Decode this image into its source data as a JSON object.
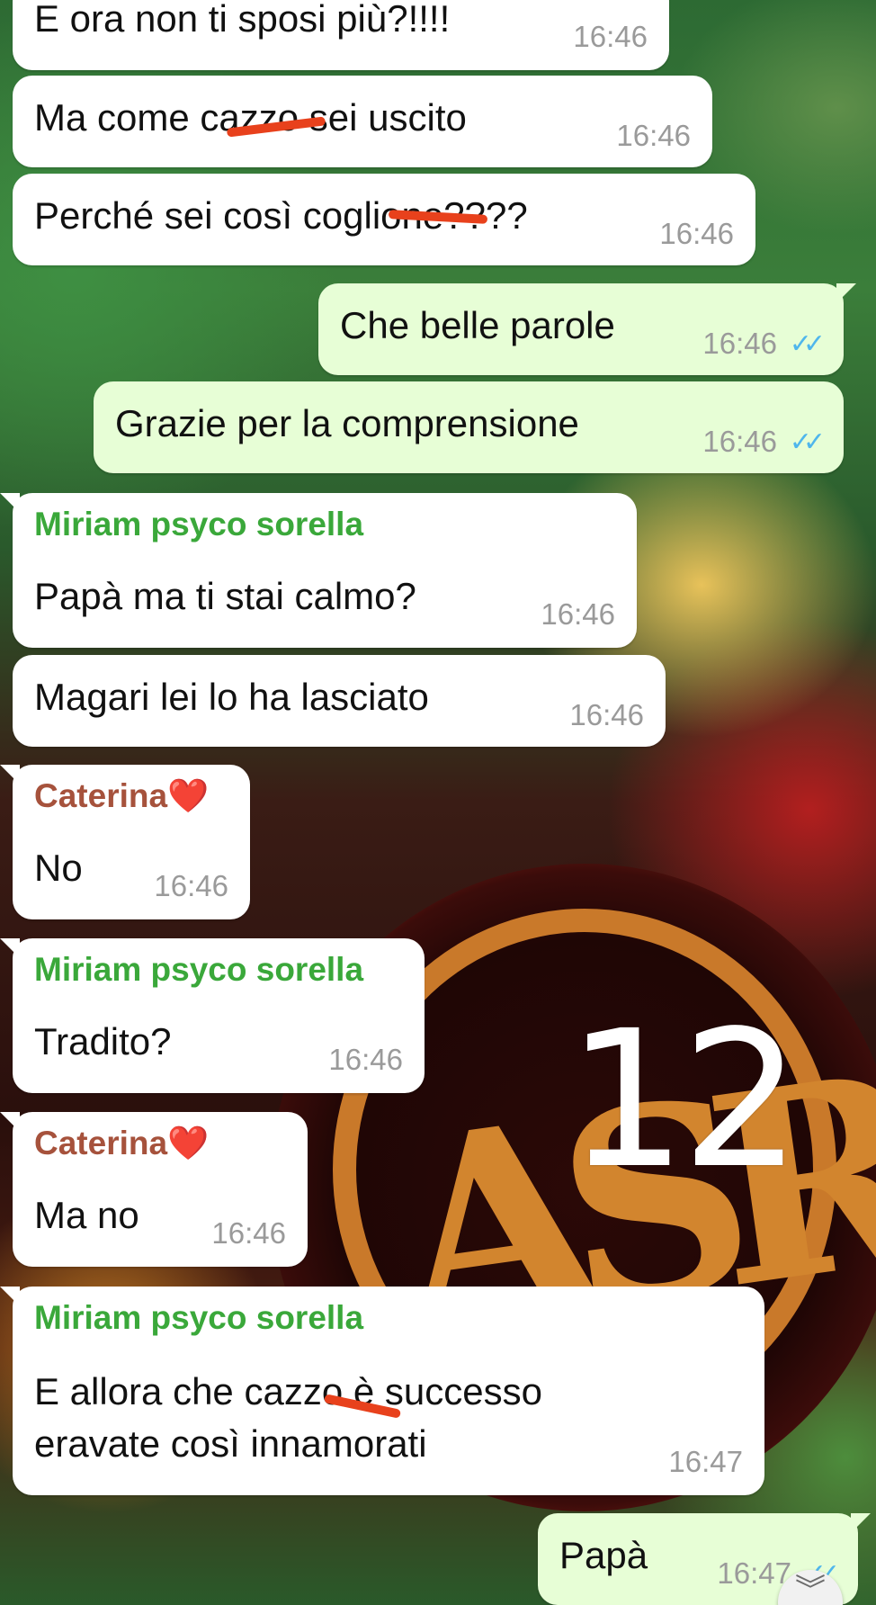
{
  "colors": {
    "incoming_bubble": "#ffffff",
    "outgoing_bubble": "#e7fed6",
    "sender_miriam": "#3aa83a",
    "sender_caterina": "#a6523c",
    "read_ticks": "#4fb6ec",
    "redaction": "#e8411c"
  },
  "messages": [
    {
      "text": "E ora non ti sposi più?!!!!",
      "time": "16:46"
    },
    {
      "text": "Ma come cazzo sei uscito",
      "time": "16:46"
    },
    {
      "text": "Perché sei così coglione????",
      "time": "16:46"
    },
    {
      "text": "Che belle parole",
      "time": "16:46",
      "ticks": "✓✓"
    },
    {
      "text": "Grazie per la comprensione",
      "time": "16:46",
      "ticks": "✓✓"
    },
    {
      "sender": "Miriam psyco sorella",
      "text": "Papà ma ti stai calmo?",
      "time": "16:46"
    },
    {
      "text": "Magari lei lo ha lasciato",
      "time": "16:46"
    },
    {
      "sender": "Caterina❤️",
      "text": "No",
      "time": "16:46"
    },
    {
      "sender": "Miriam psyco sorella",
      "text": "Tradito?",
      "time": "16:46"
    },
    {
      "sender": "Caterina❤️",
      "text": "Ma no",
      "time": "16:46"
    },
    {
      "sender": "Miriam psyco sorella",
      "line1": "E allora che cazzo è successo",
      "line2": "eravate così innamorati",
      "time": "16:47"
    },
    {
      "text": "Papà",
      "time": "16:47",
      "ticks": "✓✓"
    }
  ],
  "overlay_mark": "12",
  "scroll_button": {
    "icon": "double-chevron-down-icon",
    "glyph": "︾"
  }
}
